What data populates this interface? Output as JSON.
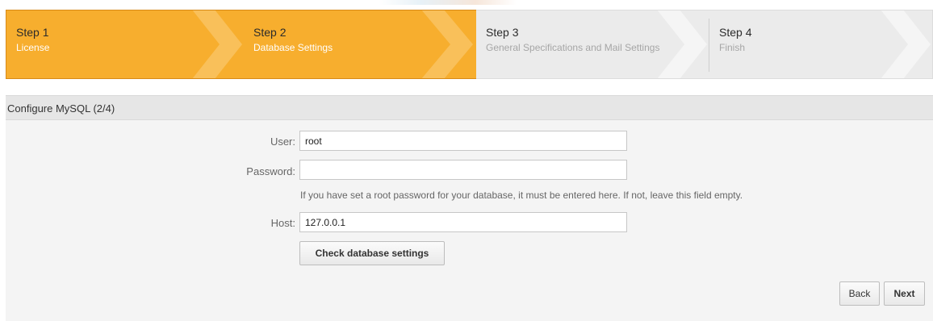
{
  "wizard": {
    "steps": [
      {
        "number": "Step 1",
        "label": "License",
        "state": "completed"
      },
      {
        "number": "Step 2",
        "label": "Database Settings",
        "state": "current"
      },
      {
        "number": "Step 3",
        "label": "General Specifications and Mail Settings",
        "state": "upcoming"
      },
      {
        "number": "Step 4",
        "label": "Finish",
        "state": "upcoming"
      }
    ],
    "colors": {
      "active": "#f7ae2e",
      "inactive": "#ebebeb"
    }
  },
  "panel": {
    "title": "Configure MySQL (2/4)"
  },
  "form": {
    "user": {
      "label": "User:",
      "value": "root"
    },
    "password": {
      "label": "Password:",
      "value": "",
      "hint": "If you have set a root password for your database, it must be entered here. If not, leave this field empty."
    },
    "host": {
      "label": "Host:",
      "value": "127.0.0.1"
    },
    "check_button": "Check database settings"
  },
  "footer": {
    "back_label": "Back",
    "next_label": "Next"
  }
}
